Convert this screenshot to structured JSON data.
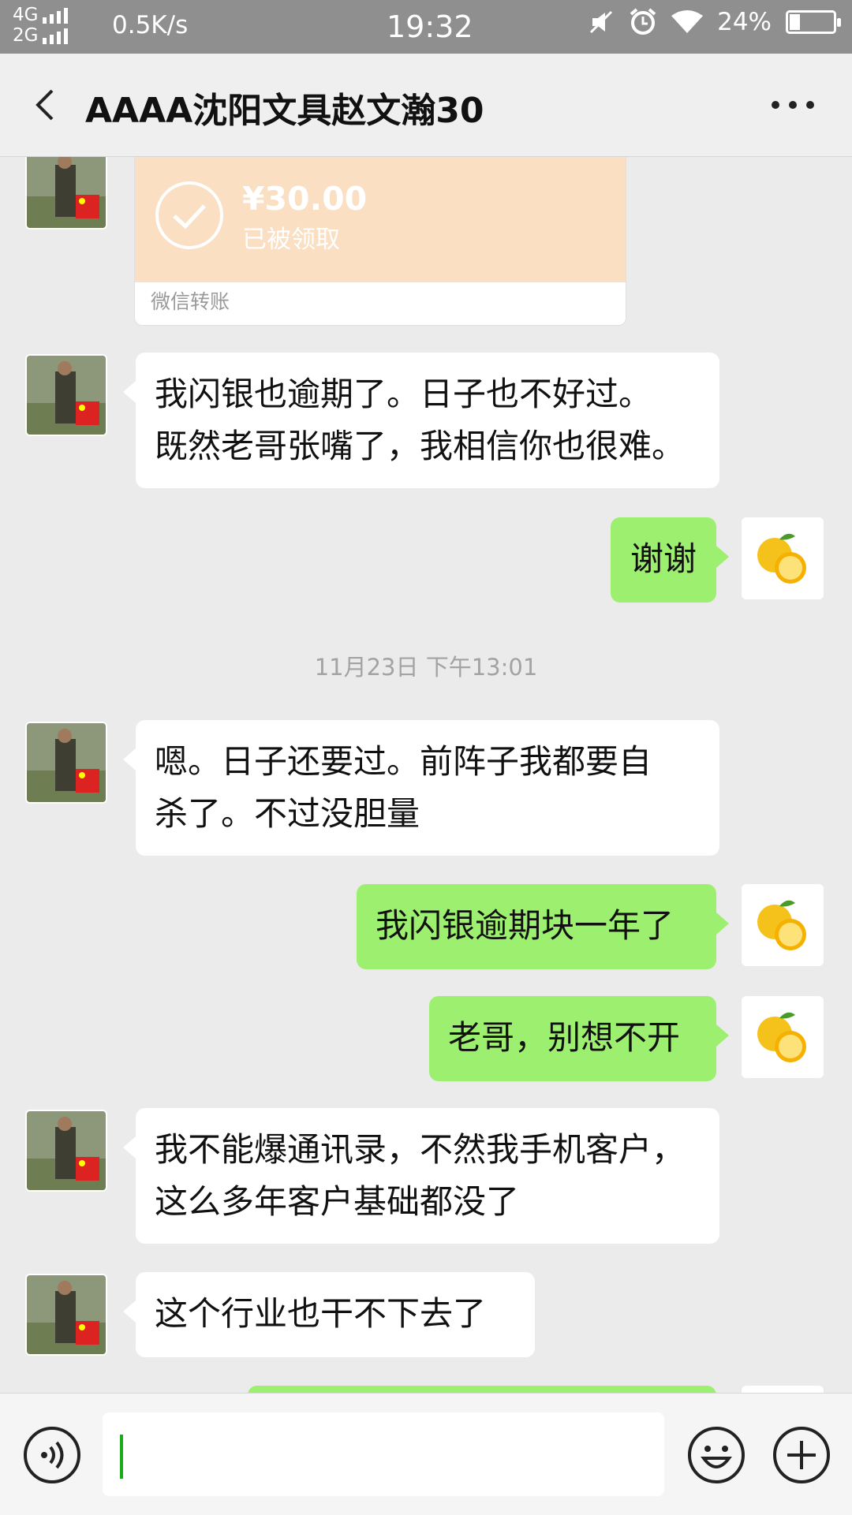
{
  "status_bar": {
    "net1": "4G",
    "net2": "2G",
    "speed": "0.5K/s",
    "time": "19:32",
    "battery": "24%",
    "battery_level": 0.24,
    "icons": [
      "mute-icon",
      "alarm-icon",
      "wifi-icon",
      "battery-icon"
    ]
  },
  "header": {
    "title": "AAAA沈阳文具赵文瀚30",
    "back_icon": "chevron-left-icon",
    "more_icon": "more-icon"
  },
  "transfer": {
    "amount": "¥30.00",
    "status": "已被领取",
    "footer": "微信转账"
  },
  "messages": {
    "m1": [
      "我闪银也逾期了。日子也不好过。",
      "既然老哥张嘴了，我相信你也很难。"
    ],
    "m2": "谢谢",
    "time": "11月23日 下午13:01",
    "m3": [
      "嗯。日子还要过。前阵子我都要自",
      "杀了。不过没胆量"
    ],
    "m4": "我闪银逾期块一年了",
    "m5": "老哥，别想不开",
    "m6": [
      "我不能爆通讯录，不然我手机客户，",
      "这么多年客户基础都没了"
    ],
    "m7": "这个行业也干不下去了"
  },
  "input_bar": {
    "value": "",
    "icons": [
      "voice-icon",
      "emoji-icon",
      "plus-icon"
    ]
  },
  "colors": {
    "outgoing": "#9def6f",
    "incoming": "#ffffff",
    "transfer": "#fadfc3",
    "background": "#ebebeb"
  }
}
